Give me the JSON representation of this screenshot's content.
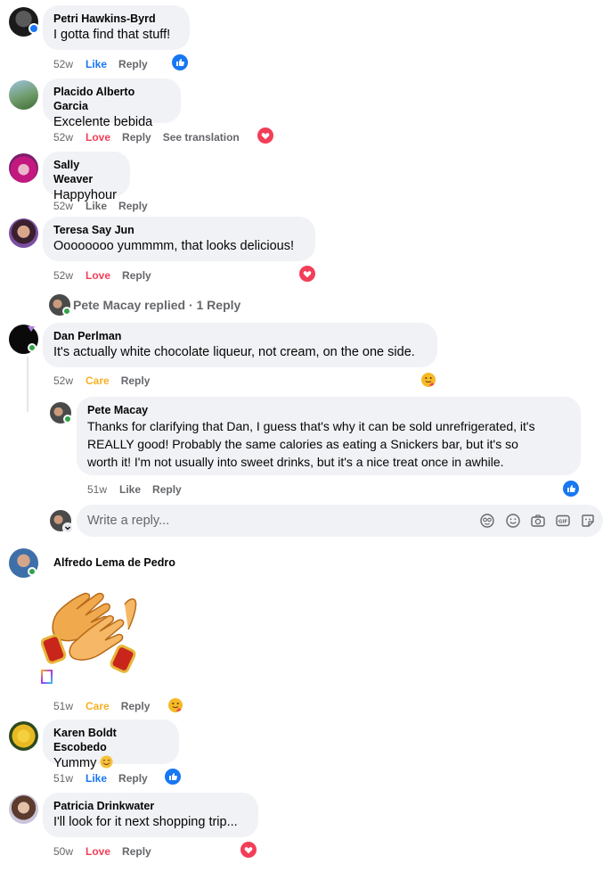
{
  "comments": [
    {
      "author": "Petri Hawkins-Byrd",
      "text": "I gotta find that stuff!",
      "time": "52w",
      "like": "Like",
      "reply": "Reply",
      "reaction": "like-icon"
    },
    {
      "author": "Placido Alberto Garcia",
      "text": "Excelente bebida",
      "time": "52w",
      "like": "Love",
      "reply": "Reply",
      "extra": "See translation",
      "reaction": "love-icon"
    },
    {
      "author": "Sally Weaver",
      "text": "Happyhour",
      "time": "52w",
      "like": "Like",
      "reply": "Reply"
    },
    {
      "author": "Teresa Say Jun",
      "text": "Oooooooo yummmm, that looks delicious!",
      "time": "52w",
      "like": "Love",
      "reply": "Reply",
      "reaction": "love-icon"
    },
    {
      "author": "Dan Perlman",
      "text": "It's actually white chocolate liqueur, not cream, on the one side.",
      "time": "52w",
      "like": "Care",
      "reply": "Reply",
      "reaction": "care-icon"
    },
    {
      "author": "Alfredo Lema de Pedro",
      "time": "51w",
      "like": "Care",
      "reply": "Reply",
      "reaction": "care-icon"
    },
    {
      "author": "Karen Boldt Escobedo",
      "text": "Yummy",
      "time": "51w",
      "like": "Like",
      "reply": "Reply",
      "reaction": "like-icon"
    },
    {
      "author": "Patricia Drinkwater",
      "text": "I'll look for it next shopping trip...",
      "time": "50w",
      "like": "Love",
      "reply": "Reply",
      "reaction": "love-icon"
    }
  ],
  "replied_summary": "Pete Macay replied · 1 Reply",
  "nested_reply": {
    "author": "Pete Macay",
    "lines": [
      "Thanks for clarifying that Dan, I guess that's why it can be sold unrefrigerated, it's",
      "REALLY good! Probably the same calories as eating a Snickers bar, but it's so",
      "worth it! I'm not usually into sweet drinks, but it's a nice treat once in awhile."
    ],
    "time": "51w",
    "like": "Like",
    "reply": "Reply",
    "reaction": "like-icon"
  },
  "reply_box": {
    "placeholder": "Write a reply..."
  },
  "colors": {
    "like": "#1877f2",
    "love": "#f33e58",
    "care": "#f7b125",
    "bubble": "#f0f2f5",
    "meta": "#65676b"
  }
}
